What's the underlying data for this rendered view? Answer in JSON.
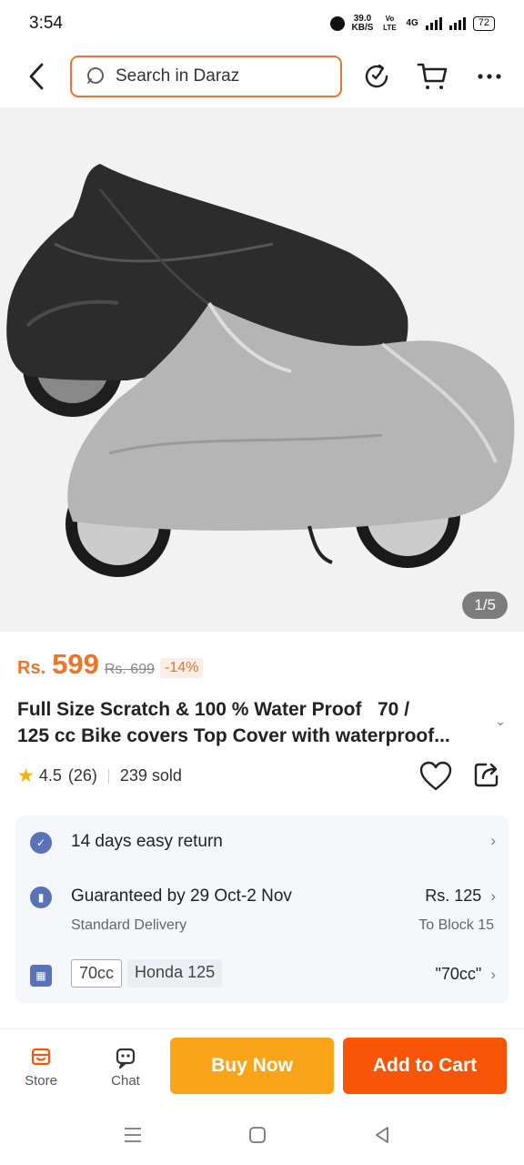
{
  "status_bar": {
    "time": "3:54",
    "speed": "39.0",
    "speed_unit": "KB/S",
    "volte": "Vo LTE",
    "net": "4G",
    "battery": "72"
  },
  "nav": {
    "search_placeholder": "Search in Daraz",
    "icons": [
      "back-icon",
      "search-icon",
      "history-icon",
      "cart-icon",
      "more-icon"
    ],
    "accent_color": "#f57224"
  },
  "gallery": {
    "counter": "1/5"
  },
  "product": {
    "currency": "Rs.",
    "price": "599",
    "old_price": "Rs. 699",
    "discount": "-14%",
    "title_line1": "Full Size Scratch & 100 % Water Proof   70 /",
    "title_line2": "125 cc Bike covers Top Cover with waterproof...",
    "rating": "4.5",
    "reviews": "(26)",
    "sold": "239 sold"
  },
  "info": {
    "return_text": "14 days easy return",
    "delivery_text": "Guaranteed by 29 Oct-2 Nov",
    "delivery_sub": "Standard Delivery",
    "delivery_price": "Rs. 125",
    "delivery_to": "To Block 15",
    "variants": [
      "70cc",
      "Honda 125"
    ],
    "selected_variant": "\"70cc\""
  },
  "bottom_bar": {
    "store_label": "Store",
    "chat_label": "Chat",
    "buy_now_label": "Buy Now",
    "add_to_cart_label": "Add to Cart",
    "buy_color": "#faa41a",
    "cart_color": "#f85606"
  }
}
